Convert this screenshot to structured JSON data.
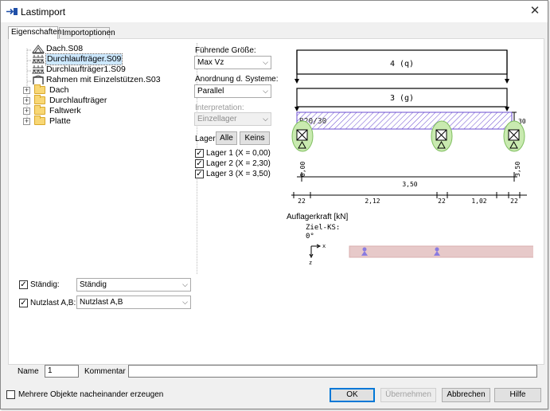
{
  "window": {
    "title": "Lastimport",
    "close_glyph": "✕"
  },
  "tabs": [
    {
      "label": "Eigenschaften",
      "active": true
    },
    {
      "label": "Importoptionen",
      "active": false
    }
  ],
  "tree": {
    "items": [
      {
        "label": "Dach.S08",
        "icon": "roof-truss-icon"
      },
      {
        "label": "Durchlaufträger.S09",
        "icon": "continuous-beam-icon",
        "selected": true
      },
      {
        "label": "Durchlaufträger1.S09",
        "icon": "continuous-beam-icon"
      },
      {
        "label": "Rahmen mit Einzelstützen.S03",
        "icon": "frame-icon"
      },
      {
        "label": "Dach",
        "icon": "folder-icon",
        "expander": "+"
      },
      {
        "label": "Durchlaufträger",
        "icon": "folder-icon",
        "expander": "+"
      },
      {
        "label": "Faltwerk",
        "icon": "folder-icon",
        "expander": "+"
      },
      {
        "label": "Platte",
        "icon": "folder-icon",
        "expander": "+"
      }
    ]
  },
  "options": {
    "fuehrende_label": "Führende Größe:",
    "fuehrende_value": "Max Vz",
    "anordnung_label": "Anordnung d. Systeme:",
    "anordnung_value": "Parallel",
    "interpretation_label": "Interpretation:",
    "interpretation_value": "Einzellager",
    "lager_label": "Lager:",
    "alle_label": "Alle",
    "keins_label": "Keins",
    "lager_items": [
      {
        "label": "Lager 1 (X = 0,00)",
        "checked": true
      },
      {
        "label": "Lager 2 (X = 2,30)",
        "checked": true
      },
      {
        "label": "Lager 3 (X = 3,50)",
        "checked": true
      }
    ]
  },
  "diagram": {
    "load_top": "4 (q)",
    "load_bottom": "3 (g)",
    "beam_label": "B20/30",
    "height_label": "30",
    "dim_start": "0,00",
    "dim_end": "3,50",
    "dim_total": "3,50",
    "dim_segments": [
      "22",
      "2,12",
      "22",
      "1,02",
      "22"
    ],
    "reaction_title": "Auflagerkraft [kN]",
    "ziel_ks": "Ziel-KS:",
    "angle": "0°",
    "axis_x": "x",
    "axis_z": "z",
    "colors": {
      "support_fill": "#c9eab0",
      "force_band": "#e7c9c9",
      "hatch": "#6b4dd1",
      "support_marker": "#8a7be0"
    }
  },
  "load_cases": [
    {
      "check_label": "Ständig:",
      "value": "Ständig",
      "checked": true
    },
    {
      "check_label": "Nutzlast A,B:",
      "value": "Nutzlast A,B",
      "checked": true
    }
  ],
  "name_field": {
    "label": "Name",
    "value": "1"
  },
  "comment_field": {
    "label": "Kommentar",
    "value": ""
  },
  "footer": {
    "multi_label": "Mehrere Objekte nacheinander erzeugen",
    "multi_checked": false,
    "ok": "OK",
    "apply": "Übernehmen",
    "cancel": "Abbrechen",
    "help": "Hilfe"
  }
}
